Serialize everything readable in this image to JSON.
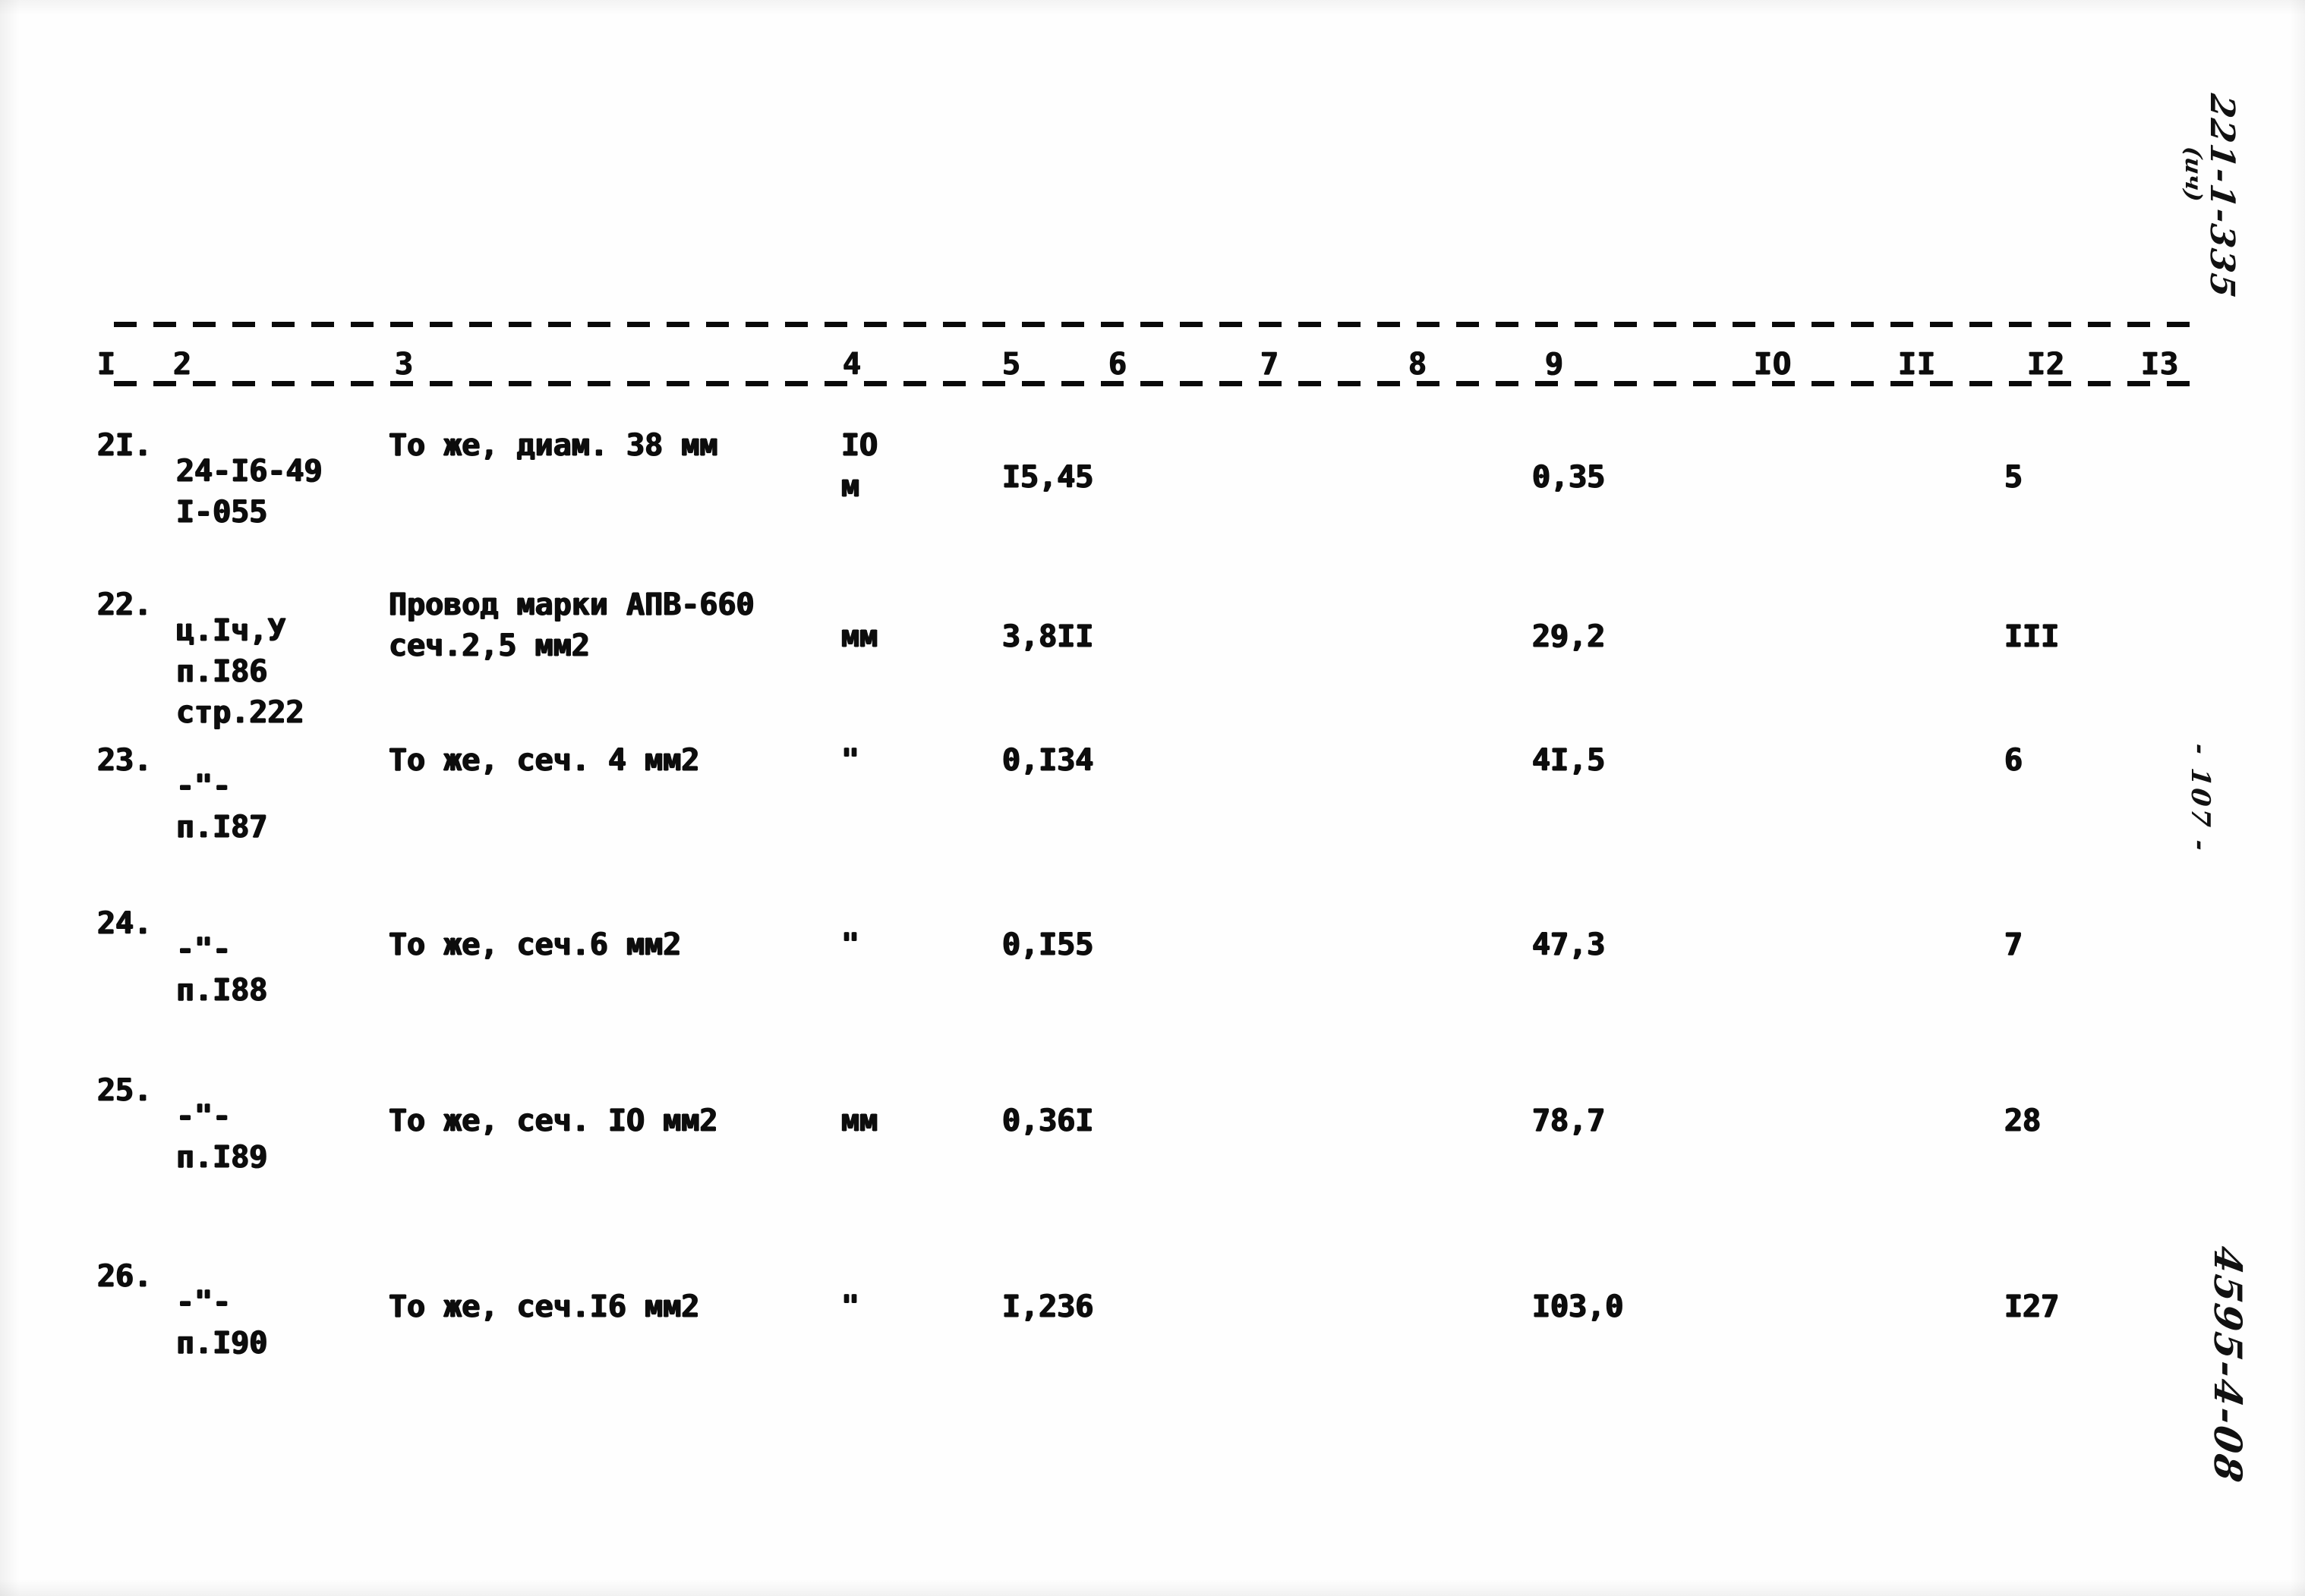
{
  "document": {
    "type": "scanned-estimate-table",
    "language": "ru"
  },
  "table": {
    "column_numbers": [
      "I",
      "2",
      "3",
      "4",
      "5",
      "6",
      "7",
      "8",
      "9",
      "IO",
      "II",
      "I2",
      "I3"
    ],
    "rows": [
      {
        "number": "2I.",
        "code_lines": [
          "24-I6-49",
          "I-055"
        ],
        "description_lines": [
          "То же, диам. 38 мм"
        ],
        "unit_lines": [
          "IO",
          "м"
        ],
        "quantity": "I5,45",
        "col9": "0,35",
        "col12": "5"
      },
      {
        "number": "22.",
        "code_lines": [
          "ц.Iч,У",
          "п.I86",
          "стр.222"
        ],
        "description_lines": [
          "Провод марки АПВ-660",
          "сеч.2,5 мм2"
        ],
        "unit_lines": [
          "мм"
        ],
        "quantity": "3,8II",
        "col9": "29,2",
        "col12": "III"
      },
      {
        "number": "23.",
        "code_lines": [
          "-\"-",
          "п.I87"
        ],
        "description_lines": [
          "То же, сеч. 4 мм2"
        ],
        "unit_lines": [
          "\""
        ],
        "quantity": "0,I34",
        "col9": "4I,5",
        "col12": "6"
      },
      {
        "number": "24.",
        "code_lines": [
          "-\"-",
          "п.I88"
        ],
        "description_lines": [
          "То же, сеч.6 мм2"
        ],
        "unit_lines": [
          "\""
        ],
        "quantity": "0,I55",
        "col9": "47,3",
        "col12": "7"
      },
      {
        "number": "25.",
        "code_lines": [
          "-\"-",
          "п.I89"
        ],
        "description_lines": [
          "То же, сеч. IO мм2"
        ],
        "unit_lines": [
          "мм"
        ],
        "quantity": "0,36I",
        "col9": "78,7",
        "col12": "28"
      },
      {
        "number": "26.",
        "code_lines": [
          "-\"-",
          "п.I90"
        ],
        "description_lines": [
          "То же, сеч.I6 мм2"
        ],
        "unit_lines": [
          "\""
        ],
        "quantity": "I,236",
        "col9": "I03,0",
        "col12": "I27"
      }
    ]
  },
  "marginalia": {
    "top_right_code": "221-1-335",
    "top_right_paren": "(ич)",
    "page_number": "- 107 -",
    "bottom_right_code": "4595-4-08"
  }
}
